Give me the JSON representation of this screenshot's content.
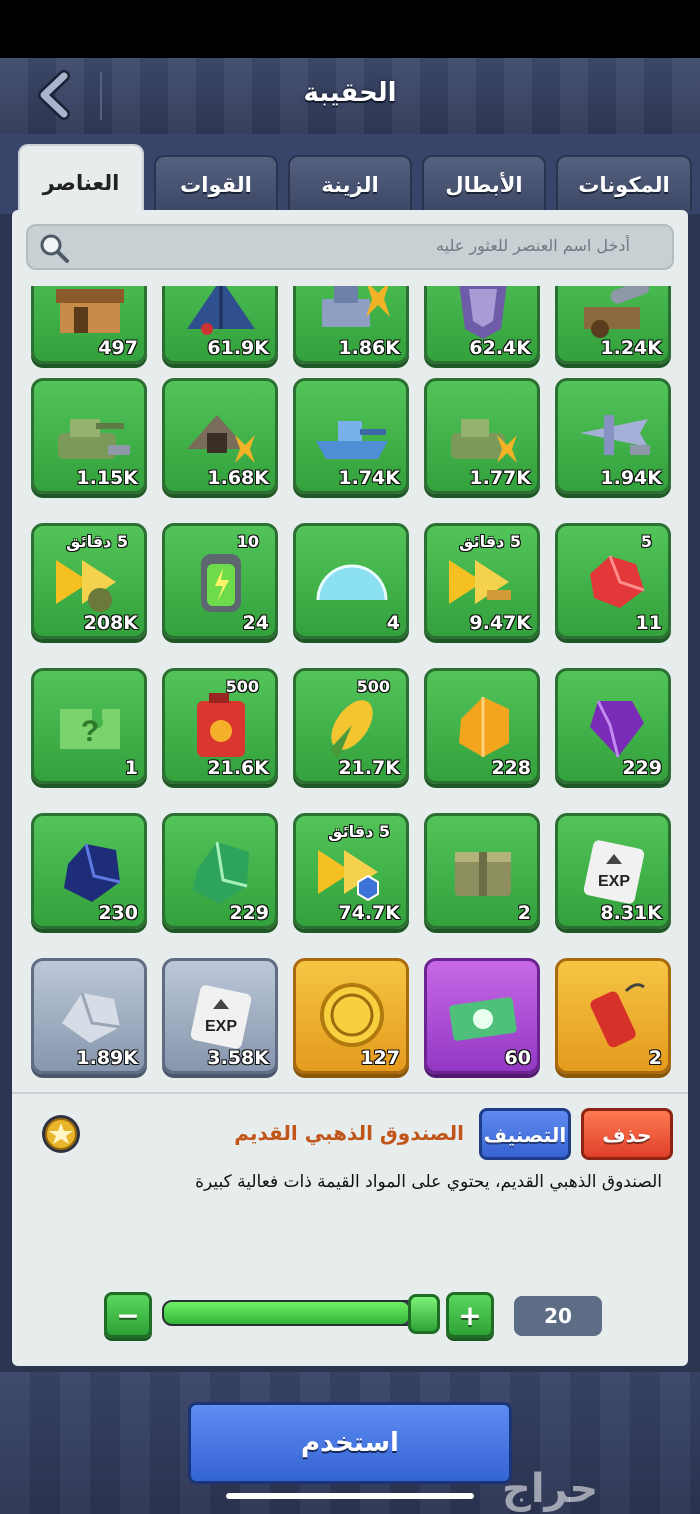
{
  "header": {
    "title": "الحقيبة"
  },
  "tabs": [
    {
      "label": "العناصر",
      "active": true
    },
    {
      "label": "القوات",
      "active": false
    },
    {
      "label": "الزينة",
      "active": false
    },
    {
      "label": "الأبطال",
      "active": false
    },
    {
      "label": "المكونات",
      "active": false
    }
  ],
  "search": {
    "placeholder": "أدخل اسم العنصر للعثور عليه"
  },
  "items": [
    {
      "count": "497",
      "tag": "",
      "style": "green",
      "icon": "building-icon"
    },
    {
      "count": "61.9K",
      "tag": "",
      "style": "green",
      "icon": "tent-icon"
    },
    {
      "count": "1.86K",
      "tag": "",
      "style": "green",
      "icon": "unit-upgrade-icon"
    },
    {
      "count": "62.4K",
      "tag": "",
      "style": "green",
      "icon": "armor-icon"
    },
    {
      "count": "1.24K",
      "tag": "",
      "style": "green",
      "icon": "cannon-icon"
    },
    {
      "count": "1.15K",
      "tag": "",
      "style": "green",
      "icon": "tank-hammer-icon"
    },
    {
      "count": "1.68K",
      "tag": "",
      "style": "green",
      "icon": "mine-upgrade-icon"
    },
    {
      "count": "1.74K",
      "tag": "",
      "style": "green",
      "icon": "ship-hammer-icon"
    },
    {
      "count": "1.77K",
      "tag": "",
      "style": "green",
      "icon": "tank-upgrade-icon"
    },
    {
      "count": "1.94K",
      "tag": "",
      "style": "green",
      "icon": "plane-hammer-icon"
    },
    {
      "count": "208K",
      "tag": "5 دقائق",
      "style": "green",
      "icon": "speedup-troops-icon"
    },
    {
      "count": "24",
      "tag": "10",
      "style": "green",
      "icon": "energy-battery-icon"
    },
    {
      "count": "4",
      "tag": "",
      "style": "green",
      "icon": "shield-dome-icon"
    },
    {
      "count": "9.47K",
      "tag": "5 دقائق",
      "style": "green",
      "icon": "speedup-build-icon"
    },
    {
      "count": "11",
      "tag": "5",
      "style": "green",
      "icon": "red-gem-icon"
    },
    {
      "count": "1",
      "tag": "",
      "style": "green",
      "icon": "mystery-puzzle-icon"
    },
    {
      "count": "21.6K",
      "tag": "500",
      "style": "green",
      "icon": "fuel-can-icon"
    },
    {
      "count": "21.7K",
      "tag": "500",
      "style": "green",
      "icon": "corn-icon"
    },
    {
      "count": "228",
      "tag": "",
      "style": "green",
      "icon": "amber-crystal-icon"
    },
    {
      "count": "229",
      "tag": "",
      "style": "green",
      "icon": "purple-gem-icon"
    },
    {
      "count": "230",
      "tag": "",
      "style": "green",
      "icon": "blue-gem-icon"
    },
    {
      "count": "229",
      "tag": "",
      "style": "green",
      "icon": "green-crystal-icon"
    },
    {
      "count": "74.7K",
      "tag": "5 دقائق",
      "style": "green",
      "icon": "speedup-research-icon"
    },
    {
      "count": "2",
      "tag": "",
      "style": "green",
      "icon": "supply-crate-icon"
    },
    {
      "count": "8.31K",
      "tag": "",
      "style": "green",
      "icon": "exp-card-icon"
    },
    {
      "count": "1.89K",
      "tag": "",
      "style": "gray",
      "icon": "silver-ore-icon"
    },
    {
      "count": "3.58K",
      "tag": "",
      "style": "gray",
      "icon": "exp-card-icon"
    },
    {
      "count": "127",
      "tag": "",
      "style": "gold",
      "icon": "gold-coin-icon"
    },
    {
      "count": "60",
      "tag": "",
      "style": "purple",
      "icon": "banknotes-icon"
    },
    {
      "count": "2",
      "tag": "",
      "style": "gold",
      "icon": "firecracker-icon"
    }
  ],
  "selected": {
    "name": "الصندوق الذهبي القديم",
    "description": "الصندوق الذهبي القديم، يحتوي على المواد القيمة ذات فعالية كبيرة",
    "sort_label": "التصنيف",
    "delete_label": "حذف"
  },
  "quantity": {
    "value": "20",
    "minus": "−",
    "plus": "+",
    "fill_fraction": 0.9
  },
  "footer": {
    "use_label": "استخدم",
    "watermark": "حراج"
  },
  "colors": {
    "green_tile": "#3fb247",
    "gray_tile": "#a4b1c4",
    "gold_tile": "#eeb031",
    "purple_tile": "#b150d6",
    "blue_button": "#4774e0",
    "red_button": "#ee5a3a"
  }
}
